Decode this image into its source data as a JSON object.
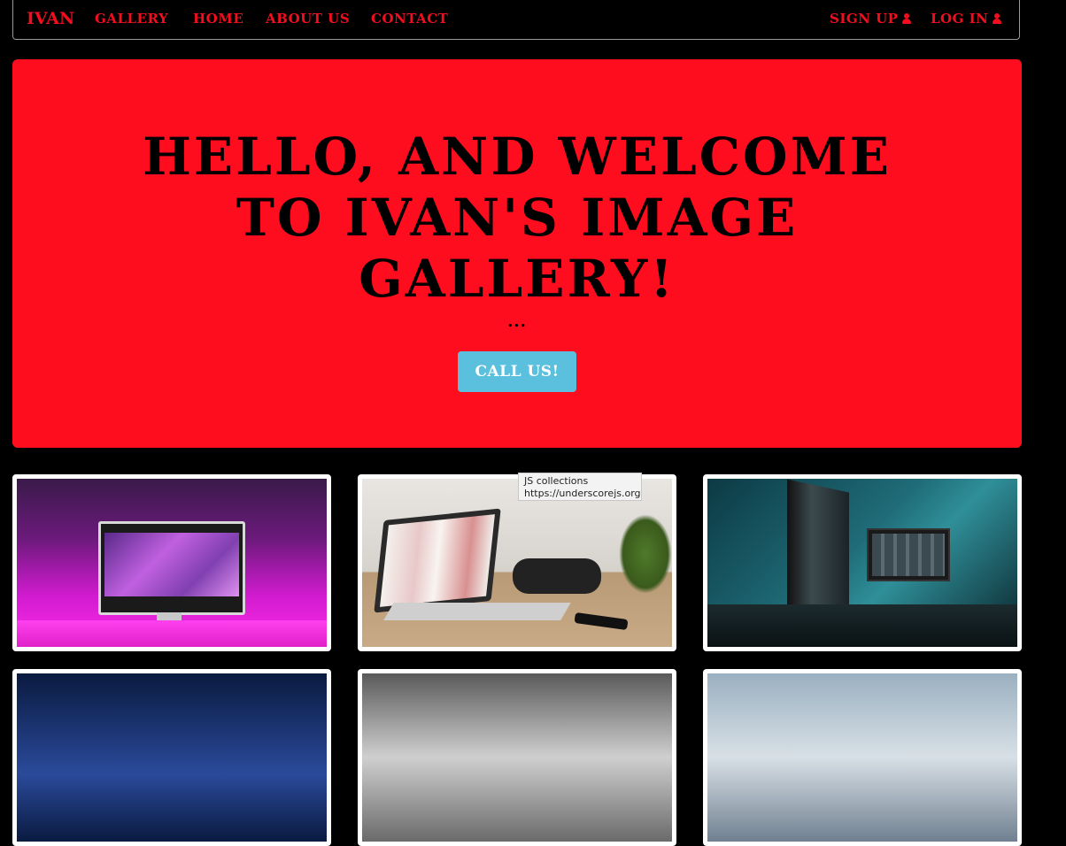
{
  "navbar": {
    "brand": "IVAN",
    "left_links": [
      "GALLERY",
      "HOME",
      "ABOUT US",
      "CONTACT"
    ],
    "sign_up": "SIGN UP",
    "log_in": "LOG IN",
    "user_icon": "user-icon",
    "accent_color": "#f20d1f"
  },
  "hero": {
    "title": "HELLO, AND WELCOME TO IVAN'S IMAGE GALLERY!",
    "ellipsis": "...",
    "button_label": "CALL US!",
    "background_color": "#fe0d1f",
    "button_color": "#5bc0de"
  },
  "gallery": {
    "thumbnails": [
      {
        "alt": "pink iMac desk setup"
      },
      {
        "alt": "laptop on wooden desk"
      },
      {
        "alt": "teal lit dual monitor setup"
      },
      {
        "alt": "blue image"
      },
      {
        "alt": "grey image"
      },
      {
        "alt": "beach image"
      }
    ]
  },
  "tooltip": {
    "line1": "JS collections",
    "line2": "https://underscorejs.org"
  }
}
